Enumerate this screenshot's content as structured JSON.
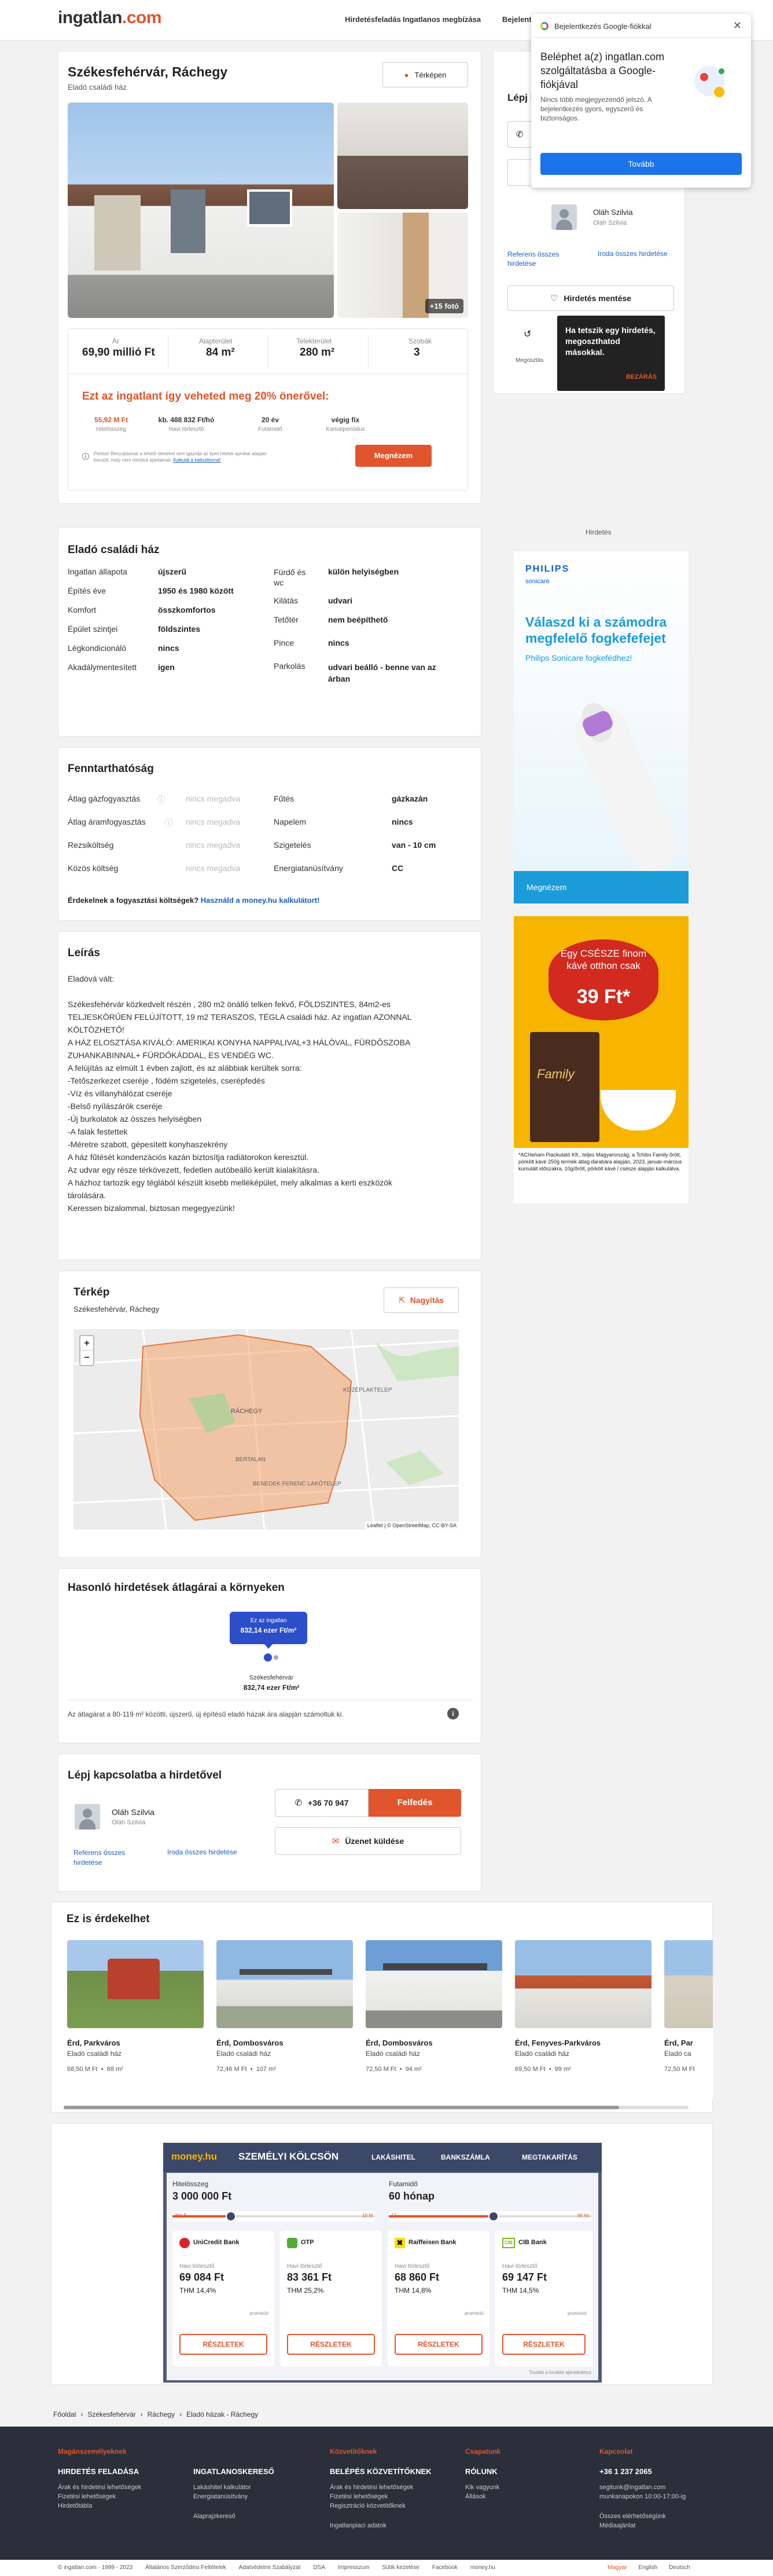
{
  "header": {
    "logo_main": "ingatlan",
    "logo_tld": ".com",
    "nav": [
      "Hirdetésfeladás",
      "Ingatlanos megbízása",
      "Bejelentkezés"
    ]
  },
  "google_popup": {
    "title": "Bejelentkezés Google-fiókkal",
    "heading": "Beléphet a(z) ingatlan.com szolgáltatásba a Google-fiókjával",
    "body": "Nincs több megjegyezendő jelszó. A bejelentkezés gyors, egyszerű és biztonságos.",
    "button": "Tovább"
  },
  "listing": {
    "title": "Székesfehérvár, Ráchegy",
    "subtitle": "Eladó családi ház",
    "map_button": "Térképen",
    "photo_count": "+15 fotó",
    "stats": [
      {
        "label": "Ár",
        "value": "69,90 millió Ft"
      },
      {
        "label": "Alapterület",
        "value": "84 m²"
      },
      {
        "label": "Telekterület",
        "value": "280 m²"
      },
      {
        "label": "Szobák",
        "value": "3"
      }
    ],
    "offer_title": "Ezt az ingatlant így veheted meg 20% önerővel:",
    "offer_items": [
      {
        "value": "55,92 M Ft",
        "label": "Hitelösszeg"
      },
      {
        "value": "kb. 488 832 Ft/hó",
        "label": "Havi törlesztő"
      },
      {
        "value": "20 év",
        "label": "Futamidő"
      },
      {
        "value": "végig fix",
        "label": "Kamatperiódus"
      }
    ],
    "offer_note": "Pontos! Benyújtásnak a lehető ötleteket sem igazolja az ilyen hitelek aprókat alapján becsült, mely nem minősül ajánlatnak.",
    "offer_note_link": "Kalkulál a kalkulátorral!",
    "offer_button": "Megnézem"
  },
  "contact_side": {
    "title": "Lépj kapcsolatba",
    "agent_name": "Oláh Szilvia",
    "agent_sub": "Oláh Szilvia",
    "link1": "Referens összes hirdetése",
    "link2": "Iroda összes hirdetése",
    "save": "Hirdetés mentése",
    "share": "Megosztás",
    "tooltip": "Ha tetszik egy hirdetés, megoszthatod másokkal.",
    "tooltip_close": "BEZÁRÁS"
  },
  "ads": {
    "label": "Hirdetés",
    "ad1_brand": "PHILIPS",
    "ad1_sub": "sonicare",
    "ad1_headline": "Válaszd ki a számodra megfelelő fogkefefejet",
    "ad1_tag": "Philips Sonicare fogkefédhez!",
    "ad1_button": "Megnézem",
    "ad2_line1": "Egy CSÉSZE finom kávé otthon csak",
    "ad2_price": "39 Ft*",
    "ad2_product": "Family",
    "ad2_foot": "*ACHeham Piackutató Kft., teljes Magyarország, a Tchibo Family őrölt, pörkölt kávé 250g termék átlag darabára alapján, 2023. január-március kumulált időszakra, 10g/őrölt, pörkölt kávé / csésze alapján kalkulálva."
  },
  "details": {
    "title": "Eladó családi ház",
    "left": [
      {
        "label": "Ingatlan állapota",
        "value": "újszerű"
      },
      {
        "label": "Építés éve",
        "value": "1950 és 1980 között"
      },
      {
        "label": "Komfort",
        "value": "összkomfortos"
      },
      {
        "label": "Épület szintjei",
        "value": "földszintes"
      },
      {
        "label": "Légkondicionáló",
        "value": "nincs"
      },
      {
        "label": "Akadálymentesített",
        "value": "igen"
      }
    ],
    "right": [
      {
        "label": "Fürdő és wc",
        "value": "külön helyiségben"
      },
      {
        "label": "Kilátás",
        "value": "udvari"
      },
      {
        "label": "Tetőtér",
        "value": "nem beépíthető"
      },
      {
        "label": "Pince",
        "value": "nincs"
      },
      {
        "label": "Parkolás",
        "value": "udvari beálló - benne van az árban"
      }
    ]
  },
  "sustain": {
    "title": "Fenntarthatóság",
    "left": [
      {
        "label": "Átlag gázfogyasztás",
        "value": "nincs megadva"
      },
      {
        "label": "Átlag áramfogyasztás",
        "value": "nincs megadva"
      },
      {
        "label": "Rezsiköltség",
        "value": "nincs megadva"
      },
      {
        "label": "Közös költség",
        "value": "nincs megadva"
      }
    ],
    "right": [
      {
        "label": "Fűtés",
        "value": "gázkazán"
      },
      {
        "label": "Napelem",
        "value": "nincs"
      },
      {
        "label": "Szigetelés",
        "value": "van - 10 cm"
      },
      {
        "label": "Energiatanúsítvány",
        "value": "CC"
      }
    ],
    "note": "Érdekelnek a fogyasztási költségek?",
    "note_link": "Használd a money.hu kalkulátort!"
  },
  "description": {
    "title": "Leírás",
    "lines": [
      "Eladóvá vált:",
      "",
      "Székesfehérvár közkedvelt részén , 280 m2 önálló telken fekvő, FÖLDSZINTES, 84m2-es",
      "TELJESKÖRŰEN FELÚJÍTOTT, 19 m2 TERASZOS, TÉGLA családi ház. Az ingatlan AZONNAL",
      "KÖLTÖZHETŐ!",
      "A HÁZ ELOSZTÁSA KIVÁLÓ: AMERIKAI KONYHA NAPPALIVAL+3 HÁLÓVAL, FÜRDŐSZOBA",
      "ZUHANKABINNAL+ FÜRDŐKÁDDAL, ES VENDÉG WC.",
      "A felújítás az elmúlt 1 évben zajlott, és az alábbiak kerültek sorra:",
      "-Tetőszerkezet cseréje , födém szigetelés, cserépfedés",
      "-Víz és villanyhálózat cseréje",
      "-Belső nyílászárók cseréje",
      "-Új burkolatok az összes helyiségben",
      "-A falak festettek",
      "-Méretre szabott, gépesített konyhaszekrény",
      "A ház fűtését kondenzációs kazán biztosítja radiátorokon keresztül.",
      "Az udvar egy része térkövezett, fedetlen autóbeálló került kialakításra.",
      "A házhoz tartozik egy téglából készült kisebb melléképület, mely alkalmas a kerti eszközök",
      "tárolására.",
      "Keressen bizalommal, biztosan megegyezünk!"
    ]
  },
  "map": {
    "title": "Térkép",
    "subtitle": "Székesfehérvár, Ráchegy",
    "enlarge": "Nagyítás",
    "zoom_in": "+",
    "zoom_out": "−",
    "attribution": "Leaflet | © OpenStreetMap, CC-BY-SA",
    "labels": [
      "RÁCHEGY",
      "KÖZÉPLAKTELEP",
      "BERTALAN",
      "BENEDEK FERENC LAKÓTELEP"
    ]
  },
  "price_compare": {
    "title": "Hasonló hirdetések átlagárai a környeken",
    "bubble_line1": "Ez az ingatlan",
    "bubble_line2": "832,14 ezer Ft/m²",
    "avg_line1": "Székesfehérvár",
    "avg_line2": "832,74 ezer Ft/m²",
    "note": "Az átlagárat a 80-119 m² közötti, újszerű, új építésű eladó házak ára alapján számoltuk ki."
  },
  "contact_main": {
    "title": "Lépj kapcsolatba a hirdetővel",
    "agent_name": "Oláh Szilvia",
    "agent_sub": "Oláh Szilvia",
    "link1": "Referens összes hirdetése",
    "link2": "Iroda összes hirdetése",
    "phone": "+36 70 947",
    "reveal": "Felfedés",
    "message": "Üzenet küldése"
  },
  "similar": {
    "title": "Ez is érdekelhet",
    "items": [
      {
        "loc": "Érd, Parkváros",
        "type": "Eladó családi ház",
        "price": "68,50 M Ft",
        "area": "88 m²"
      },
      {
        "loc": "Érd, Dombosváros",
        "type": "Eladó családi ház",
        "price": "72,46 M Ft",
        "area": "107 m²"
      },
      {
        "loc": "Érd, Dombosváros",
        "type": "Eladó családi ház",
        "price": "72,50 M Ft",
        "area": "94 m²"
      },
      {
        "loc": "Érd, Fenyves-Parkváros",
        "type": "Eladó családi ház",
        "price": "69,50 M Ft",
        "area": "99 m²"
      },
      {
        "loc": "Érd, Par",
        "type": "Eladó ca",
        "price": "72,50 M Ft",
        "area": ""
      }
    ]
  },
  "loan": {
    "brand": "money.hu",
    "title": "SZEMÉLYI KÖLCSÖN",
    "tabs": [
      "LAKÁSHITEL",
      "BANKSZÁMLA",
      "MEGTAKARÍTÁS"
    ],
    "amount_label": "Hitelösszeg",
    "amount": "3 000 000 Ft",
    "term_label": "Futamidő",
    "term": "60 hónap",
    "amount_min": "300 E",
    "amount_max": "10 M",
    "term_min": "12",
    "term_max": "96 hó",
    "banks": [
      {
        "name": "UniCredit Bank",
        "monthly_label": "Havi törlesztő",
        "monthly": "69 084 Ft",
        "thm": "THM 14,4%",
        "tag": "promóció",
        "button": "RÉSZLETEK"
      },
      {
        "name": "OTP",
        "monthly_label": "Havi törlesztő",
        "monthly": "83 361 Ft",
        "thm": "THM 25,2%",
        "tag": "",
        "button": "RÉSZLETEK"
      },
      {
        "name": "Raiffeisen Bank",
        "monthly_label": "Havi törlesztő",
        "monthly": "68 860 Ft",
        "thm": "THM 14,8%",
        "tag": "promóció",
        "button": "RÉSZLETEK"
      },
      {
        "name": "CIB Bank",
        "monthly_label": "Havi törlesztő",
        "monthly": "69 147 Ft",
        "thm": "THM 14,5%",
        "tag": "promóció",
        "button": "RÉSZLETEK"
      }
    ],
    "note": "Tovább a további ajánlatokhoz"
  },
  "breadcrumb": [
    "Főoldal",
    "Székesfehérvár",
    "Ráchegy",
    "Eladó házak - Ráchegy"
  ],
  "footer": {
    "cols": [
      {
        "head": "Magánszemélyeknek",
        "sub": "HIRDETÉS FELADÁSA",
        "items": [
          "Árak és hirdetési lehetőségek",
          "Fizetési lehetőségek",
          "Hirdetőtábla"
        ]
      },
      {
        "head": "",
        "sub": "INGATLANOSKERESŐ",
        "items": [
          "Lakáshitel kalkulátor",
          "Energiatanúsítvány",
          "",
          "Alaprajzkereső"
        ]
      },
      {
        "head": "Közvetítőknek",
        "sub": "BELÉPÉS KÖZVETÍTŐKNEK",
        "items": [
          "Árak és hirdetési lehetőségek",
          "Fizetési lehetőségek",
          "Regisztráció közvetítőknek",
          "",
          "Ingatlanpiaci adatok"
        ]
      },
      {
        "head": "Csapatunk",
        "sub": "RÓLUNK",
        "items": [
          "Kik vagyunk",
          "Állások"
        ]
      },
      {
        "head": "Kapcsolat",
        "sub": "+36 1 237 2065",
        "items": [
          "segitunk@ingatlan.com",
          "munkanapokon 10:00-17:00-ig",
          "",
          "Összes elérhetőségünk",
          "Médiaajánlat"
        ]
      }
    ],
    "bottom": [
      "© ingatlan.com · 1999 - 2023",
      "Általános Szerződési Feltételek",
      "Adatvédelmi Szabályzat",
      "DSA",
      "Impresszum",
      "Sütik kezelése",
      "Facebook",
      "money.hu"
    ],
    "langs": [
      "Magyar",
      "English",
      "Deutsch"
    ]
  }
}
